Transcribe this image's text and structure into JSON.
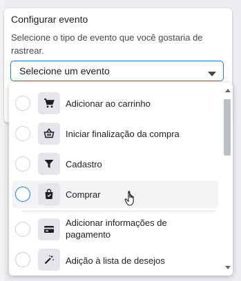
{
  "panel": {
    "title": "Configurar evento",
    "description": "Selecione o tipo de evento que você gostaria de rastrear."
  },
  "select": {
    "value": "Selecione um evento"
  },
  "dropdown": {
    "items": [
      {
        "label": "Adicionar ao carrinho",
        "icon": "cart-icon"
      },
      {
        "label": "Iniciar finalização da compra",
        "icon": "basket-icon"
      },
      {
        "label": "Cadastro",
        "icon": "funnel-icon"
      },
      {
        "label": "Comprar",
        "icon": "shopping-bag-icon"
      },
      {
        "label": "Adicionar informações de pagamento",
        "icon": "credit-card-icon"
      },
      {
        "label": "Adição à lista de desejos",
        "icon": "magic-wand-icon"
      }
    ]
  },
  "colors": {
    "accent": "#1877f2",
    "hover_bg": "#f2f3f5",
    "icon_bg": "#e4e6eb"
  }
}
